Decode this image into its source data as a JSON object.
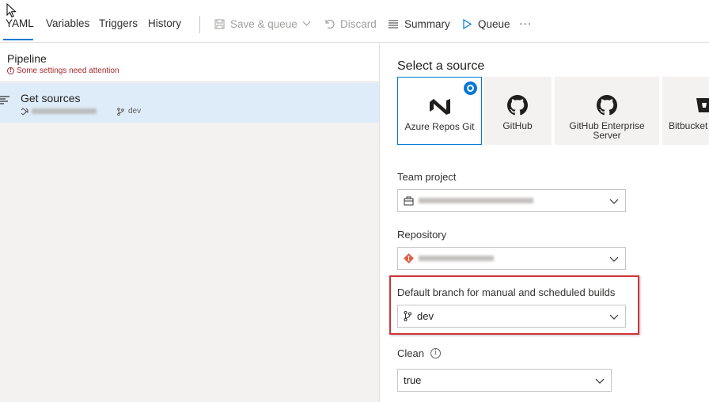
{
  "toolbar": {
    "tabs": [
      {
        "label": "YAML"
      },
      {
        "label": "Variables"
      },
      {
        "label": "Triggers"
      },
      {
        "label": "History"
      }
    ],
    "save_queue_label": "Save & queue",
    "discard_label": "Discard",
    "summary_label": "Summary",
    "queue_label": "Queue",
    "more_label": "···",
    "accent_color": "#0078d4"
  },
  "pipeline": {
    "title": "Pipeline",
    "warning": "Some settings need attention"
  },
  "get_sources": {
    "title": "Get sources",
    "branch": "dev"
  },
  "source": {
    "title": "Select a source",
    "options": [
      {
        "label": "Azure Repos Git",
        "icon": "azure-repos-icon",
        "selected": true
      },
      {
        "label": "GitHub",
        "icon": "github-icon"
      },
      {
        "label": "GitHub Enterprise Server",
        "icon": "github-icon"
      },
      {
        "label": "Bitbucket",
        "icon": "bitbucket-icon"
      }
    ]
  },
  "fields": {
    "team_project_label": "Team project",
    "repository_label": "Repository",
    "default_branch_label": "Default branch for manual and scheduled builds",
    "default_branch_value": "dev",
    "clean_label": "Clean",
    "clean_value": "true"
  },
  "highlight_color": "#d13438"
}
